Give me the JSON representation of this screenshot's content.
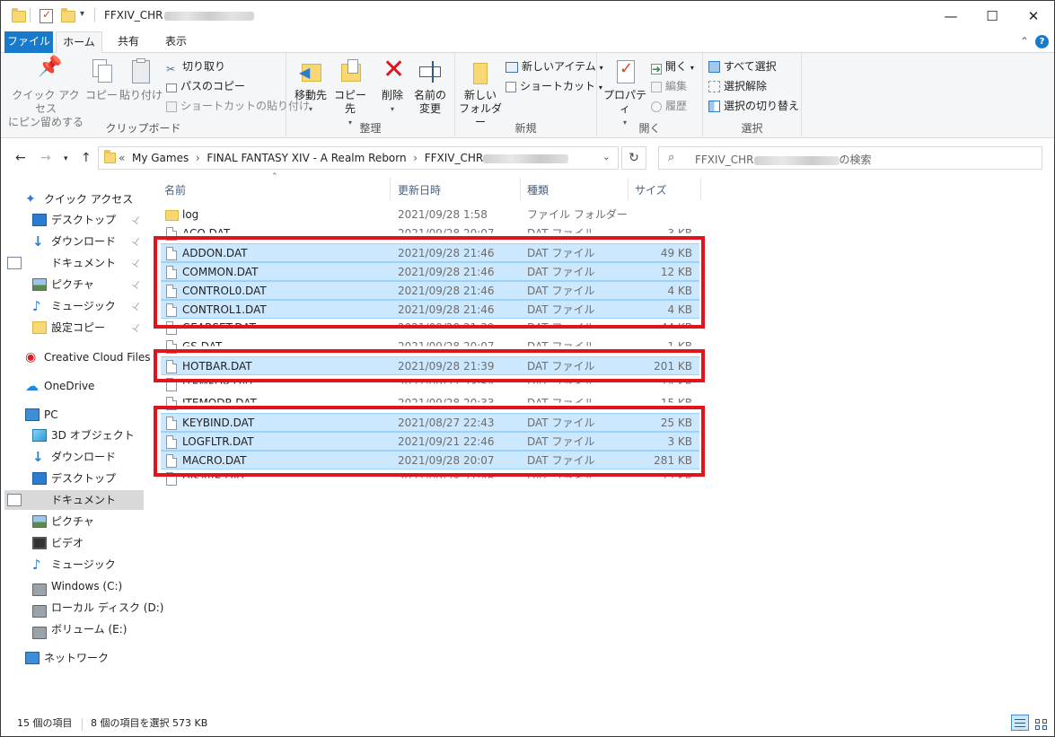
{
  "window": {
    "title_prefix": "FFXIV_CHR",
    "controls": {
      "minimize": "—",
      "maximize": "☐",
      "close": "✕"
    }
  },
  "ribbon_tabs": [
    "ファイル",
    "ホーム",
    "共有",
    "表示"
  ],
  "ribbon": {
    "clipboard": {
      "label": "クリップボード",
      "pin_quick": [
        "クイック アクセス",
        "にピン留めする"
      ],
      "copy": "コピー",
      "paste": "貼り付け",
      "cut": "切り取り",
      "copy_path": "パスのコピー",
      "paste_shortcut": "ショートカットの貼り付け"
    },
    "organize": {
      "label": "整理",
      "move_to": "移動先",
      "copy_to": "コピー先",
      "delete": "削除",
      "rename": [
        "名前の",
        "変更"
      ]
    },
    "new": {
      "label": "新規",
      "new_folder": [
        "新しい",
        "フォルダー"
      ],
      "new_item": "新しいアイテム",
      "shortcut": "ショートカット"
    },
    "open": {
      "label": "開く",
      "properties": "プロパティ",
      "open": "開く",
      "edit": "編集",
      "history": "履歴"
    },
    "select": {
      "label": "選択",
      "select_all": "すべて選択",
      "select_none": "選択解除",
      "invert": "選択の切り替え"
    }
  },
  "address": {
    "crumbs": [
      "«",
      "My Games",
      "›",
      "FINAL FANTASY XIV - A Realm Reborn",
      "›",
      "FFXIV_CHR"
    ],
    "search_prefix": "FFXIV_CHR",
    "search_suffix": "の検索"
  },
  "nav": {
    "items": [
      {
        "label": "クイック アクセス",
        "icon": "star-icon",
        "pin": false,
        "sel": false
      },
      {
        "label": "デスクトップ",
        "icon": "desktop-icon",
        "pin": true,
        "sel": false
      },
      {
        "label": "ダウンロード",
        "icon": "download-icon",
        "pin": true,
        "sel": false
      },
      {
        "label": "ドキュメント",
        "icon": "document-icon",
        "pin": true,
        "sel": false
      },
      {
        "label": "ピクチャ",
        "icon": "pictures-icon",
        "pin": true,
        "sel": false
      },
      {
        "label": "ミュージック",
        "icon": "music-icon",
        "pin": true,
        "sel": false
      },
      {
        "label": "設定コピー",
        "icon": "folder-icon",
        "pin": true,
        "sel": false
      },
      {
        "label": "Creative Cloud Files",
        "icon": "creative-cloud-icon",
        "pin": false,
        "sel": false
      },
      {
        "label": "OneDrive",
        "icon": "onedrive-icon",
        "pin": false,
        "sel": false
      },
      {
        "label": "PC",
        "icon": "pc-icon",
        "pin": false,
        "sel": false
      },
      {
        "label": "3D オブジェクト",
        "icon": "3d-objects-icon",
        "pin": false,
        "sel": false
      },
      {
        "label": "ダウンロード",
        "icon": "download-icon",
        "pin": false,
        "sel": false
      },
      {
        "label": "デスクトップ",
        "icon": "desktop-icon",
        "pin": false,
        "sel": false
      },
      {
        "label": "ドキュメント",
        "icon": "document-icon",
        "pin": false,
        "sel": true
      },
      {
        "label": "ピクチャ",
        "icon": "pictures-icon",
        "pin": false,
        "sel": false
      },
      {
        "label": "ビデオ",
        "icon": "video-icon",
        "pin": false,
        "sel": false
      },
      {
        "label": "ミュージック",
        "icon": "music-icon",
        "pin": false,
        "sel": false
      },
      {
        "label": "Windows (C:)",
        "icon": "drive-icon",
        "pin": false,
        "sel": false
      },
      {
        "label": "ローカル ディスク (D:)",
        "icon": "drive-icon",
        "pin": false,
        "sel": false
      },
      {
        "label": "ボリューム (E:)",
        "icon": "drive-icon",
        "pin": false,
        "sel": false
      },
      {
        "label": "ネットワーク",
        "icon": "network-icon",
        "pin": false,
        "sel": false
      }
    ]
  },
  "columns": {
    "name": "名前",
    "date": "更新日時",
    "type": "種類",
    "size": "サイズ"
  },
  "files": [
    {
      "name": "log",
      "date": "2021/09/28 1:58",
      "type": "ファイル フォルダー",
      "size": "",
      "folder": true,
      "selected": false,
      "cut": false
    },
    {
      "name": "ACQ.DAT",
      "date": "2021/09/28 20:07",
      "type": "DAT ファイル",
      "size": "3 KB",
      "folder": false,
      "selected": false,
      "cut": true
    },
    {
      "name": "ADDON.DAT",
      "date": "2021/09/28 21:46",
      "type": "DAT ファイル",
      "size": "49 KB",
      "folder": false,
      "selected": true,
      "cut": false
    },
    {
      "name": "COMMON.DAT",
      "date": "2021/09/28 21:46",
      "type": "DAT ファイル",
      "size": "12 KB",
      "folder": false,
      "selected": true,
      "cut": false
    },
    {
      "name": "CONTROL0.DAT",
      "date": "2021/09/28 21:46",
      "type": "DAT ファイル",
      "size": "4 KB",
      "folder": false,
      "selected": true,
      "cut": false
    },
    {
      "name": "CONTROL1.DAT",
      "date": "2021/09/28 21:46",
      "type": "DAT ファイル",
      "size": "4 KB",
      "folder": false,
      "selected": true,
      "cut": false
    },
    {
      "name": "GEARSET.DAT",
      "date": "2021/09/28 21:39",
      "type": "DAT ファイル",
      "size": "44 KB",
      "folder": false,
      "selected": false,
      "cut": true
    },
    {
      "name": "GS.DAT",
      "date": "2021/09/28 20:07",
      "type": "DAT ファイル",
      "size": "1 KB",
      "folder": false,
      "selected": false,
      "cut": true
    },
    {
      "name": "HOTBAR.DAT",
      "date": "2021/09/28 21:39",
      "type": "DAT ファイル",
      "size": "201 KB",
      "folder": false,
      "selected": true,
      "cut": false
    },
    {
      "name": "ITEMFDR.DAT",
      "date": "2021/09/27 23:54",
      "type": "DAT ファイル",
      "size": "14 KB",
      "folder": false,
      "selected": false,
      "cut": true
    },
    {
      "name": "ITEMODR.DAT",
      "date": "2021/09/28 20:33",
      "type": "DAT ファイル",
      "size": "15 KB",
      "folder": false,
      "selected": false,
      "cut": true
    },
    {
      "name": "KEYBIND.DAT",
      "date": "2021/08/27 22:43",
      "type": "DAT ファイル",
      "size": "25 KB",
      "folder": false,
      "selected": true,
      "cut": false
    },
    {
      "name": "LOGFLTR.DAT",
      "date": "2021/09/21 22:46",
      "type": "DAT ファイル",
      "size": "3 KB",
      "folder": false,
      "selected": true,
      "cut": false
    },
    {
      "name": "MACRO.DAT",
      "date": "2021/09/28 20:07",
      "type": "DAT ファイル",
      "size": "281 KB",
      "folder": false,
      "selected": true,
      "cut": false
    },
    {
      "name": "UISAVE.DAT",
      "date": "2021/09/28 21:46",
      "type": "DAT ファイル",
      "size": "72 KB",
      "folder": false,
      "selected": false,
      "cut": true
    }
  ],
  "status": {
    "count": "15 個の項目",
    "selection": "8 個の項目を選択  573 KB"
  },
  "colors": {
    "accent": "#1979ca",
    "selection": "#cce8ff",
    "highlight": "#e0141c"
  }
}
